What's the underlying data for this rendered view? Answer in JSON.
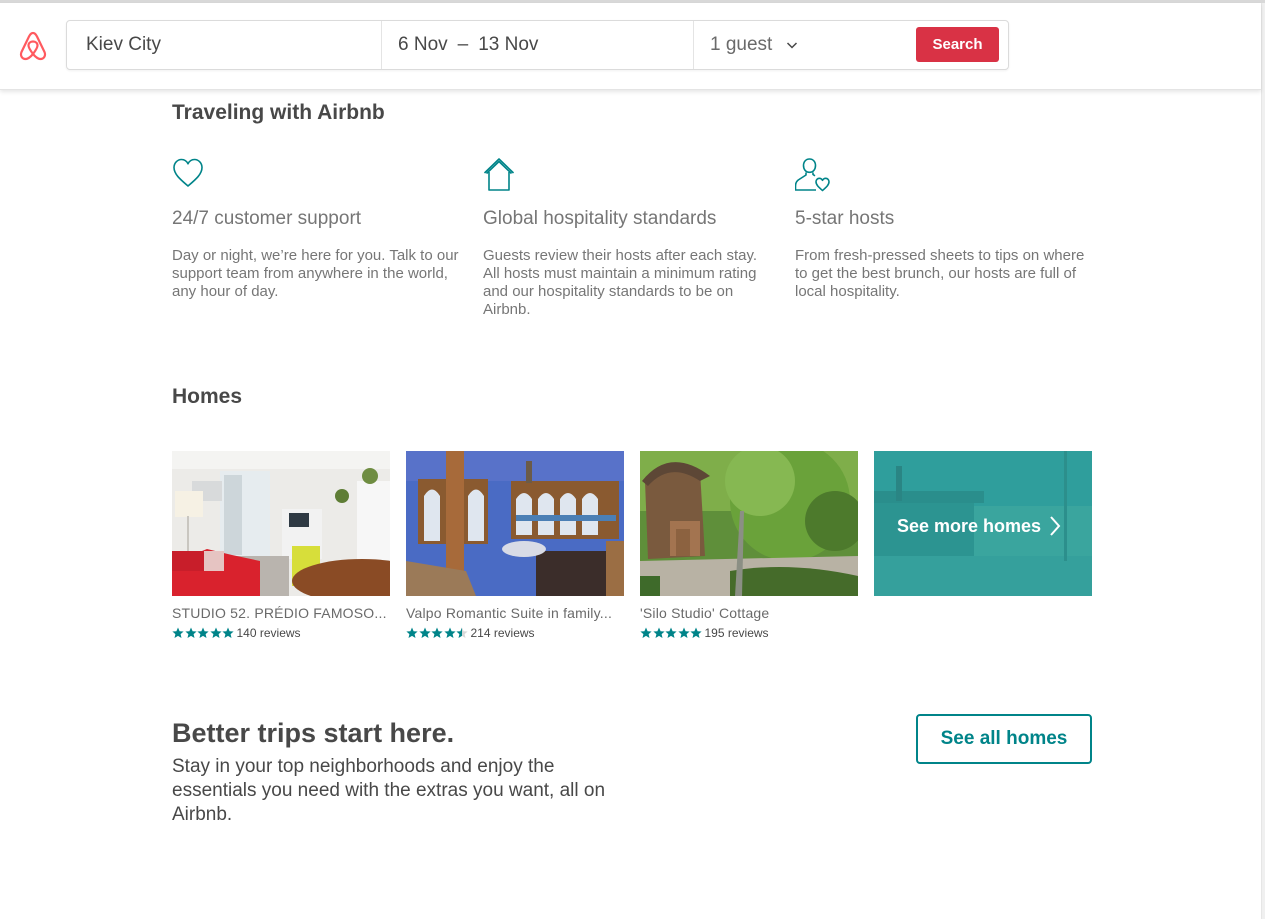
{
  "header": {
    "logo": "airbnb-logo",
    "location_value": "Kiev City",
    "check_in": "6 Nov",
    "date_separator": "–",
    "check_out": "13 Nov",
    "guests_value": "1 guest",
    "search_label": "Search"
  },
  "traveling": {
    "title": "Traveling with Airbnb",
    "features": [
      {
        "icon": "heart-icon",
        "title": "24/7 customer support",
        "description": "Day or night, we’re here for you. Talk to our support team from anywhere in the world, any hour of day."
      },
      {
        "icon": "house-icon",
        "title": "Global hospitality standards",
        "description": "Guests review their hosts after each stay. All hosts must maintain a minimum rating and our hospitality standards to be on Airbnb."
      },
      {
        "icon": "host-heart-icon",
        "title": "5-star hosts",
        "description": "From fresh-pressed sheets to tips on where to get the best brunch, our hosts are full of local hospitality."
      }
    ]
  },
  "homes": {
    "title": "Homes",
    "listings": [
      {
        "name": "STUDIO 52. PRÉDIO FAMOSO...",
        "rating": 5,
        "reviews": "140 reviews",
        "photo": "living room with red sofa"
      },
      {
        "name": "Valpo Romantic Suite in family...",
        "rating": 4.5,
        "reviews": "214 reviews",
        "photo": "blue room with arched windows"
      },
      {
        "name": "'Silo Studio' Cottage",
        "rating": 5,
        "reviews": "195 reviews",
        "photo": "wooden silo cottage in garden"
      }
    ],
    "see_more_label": "See more homes"
  },
  "promo": {
    "title": "Better trips start here.",
    "description": "Stay in your top neighborhoods and enjoy the essentials you need with the extras you want, all on Airbnb.",
    "button_label": "See all homes"
  },
  "colors": {
    "brand": "#FF5A5F",
    "search_button": "#D93245",
    "accent_teal": "#008489",
    "text_dark": "#484848",
    "text_muted": "#767676"
  }
}
